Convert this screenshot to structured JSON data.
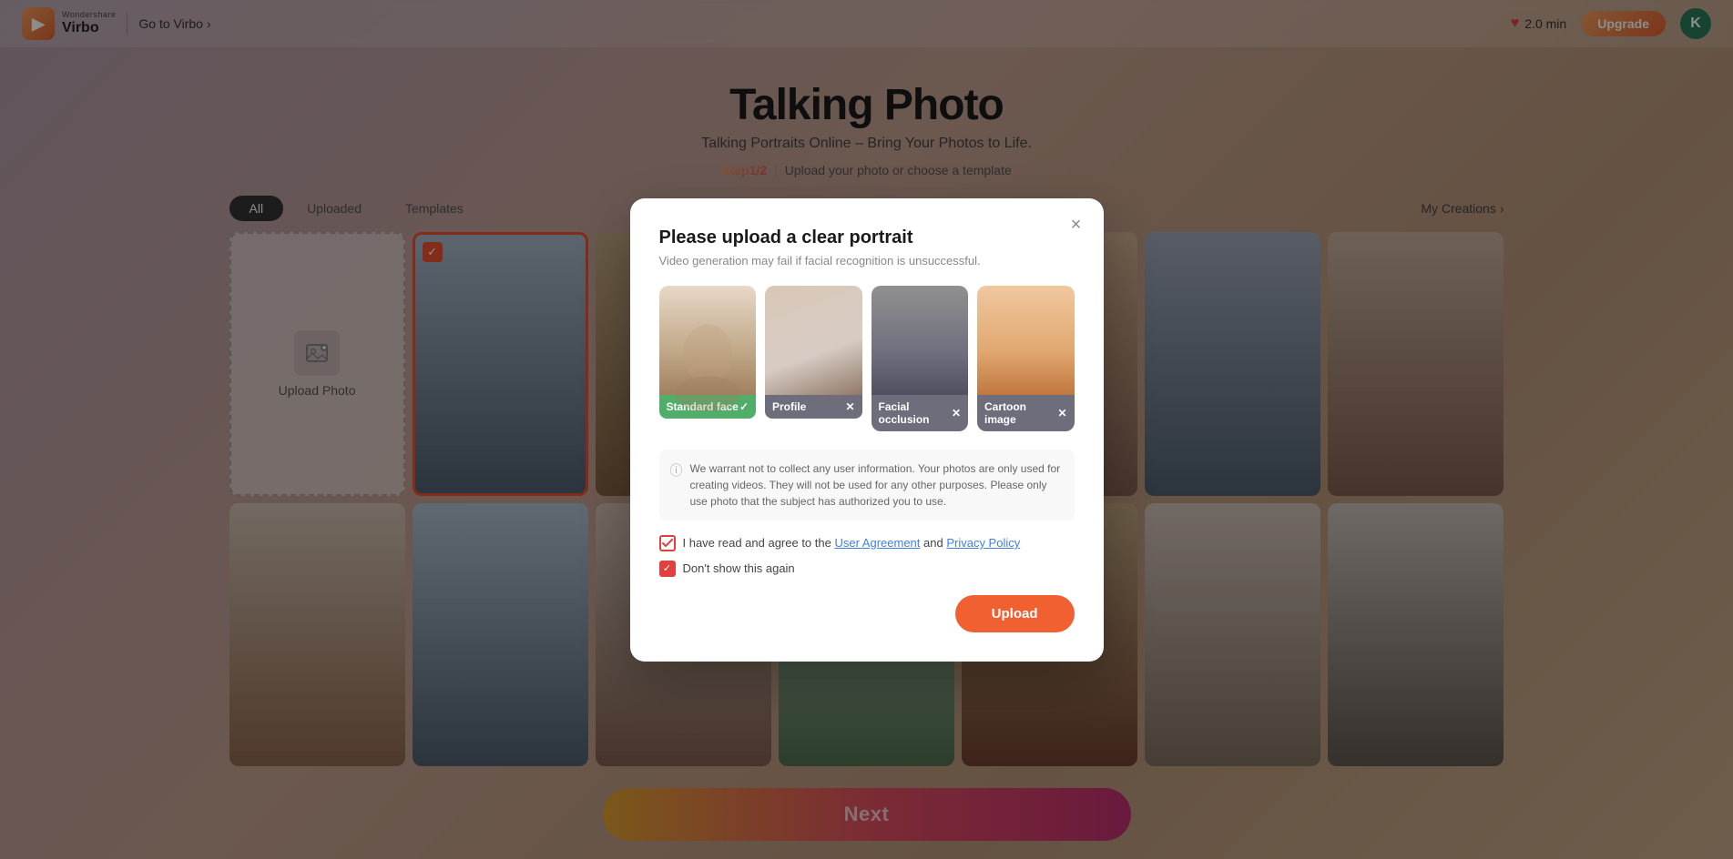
{
  "app": {
    "brand": "Wondershare",
    "product": "Virbo",
    "go_to_virbo": "Go to Virbo"
  },
  "navbar": {
    "credits": "2.0 min",
    "upgrade_label": "Upgrade",
    "avatar_initial": "K"
  },
  "page": {
    "title": "Talking Photo",
    "subtitle": "Talking Portraits Online – Bring Your Photos to Life.",
    "step": "Step1/2",
    "step_desc": "Upload your photo or choose a template"
  },
  "filter_tabs": [
    {
      "label": "All",
      "active": true
    },
    {
      "label": "Uploaded",
      "active": false
    },
    {
      "label": "Templates",
      "active": false
    }
  ],
  "my_creations": "My Creations",
  "grid": {
    "upload_label": "Upload Photo"
  },
  "next_button": "Next",
  "modal": {
    "title": "Please upload a clear portrait",
    "subtitle": "Video generation may fail if facial recognition is unsuccessful.",
    "face_examples": [
      {
        "label": "Standard face",
        "status": "good",
        "icon": "✓"
      },
      {
        "label": "Profile",
        "status": "bad",
        "icon": "✕"
      },
      {
        "label": "Facial occlusion",
        "status": "bad",
        "icon": "✕"
      },
      {
        "label": "Cartoon image",
        "status": "bad",
        "icon": "✕"
      }
    ],
    "warrant_text": "We warrant not to collect any user information. Your photos are only used for creating videos. They will not be used for any other purposes. Please only use photo that the subject has authorized you to use.",
    "agreement_text_before": "I have read and agree to the ",
    "agreement_user_link": "User Agreement",
    "agreement_and": " and ",
    "agreement_privacy_link": "Privacy Policy",
    "dont_show": "Don't show this again",
    "upload_button": "Upload",
    "close_icon": "×"
  }
}
